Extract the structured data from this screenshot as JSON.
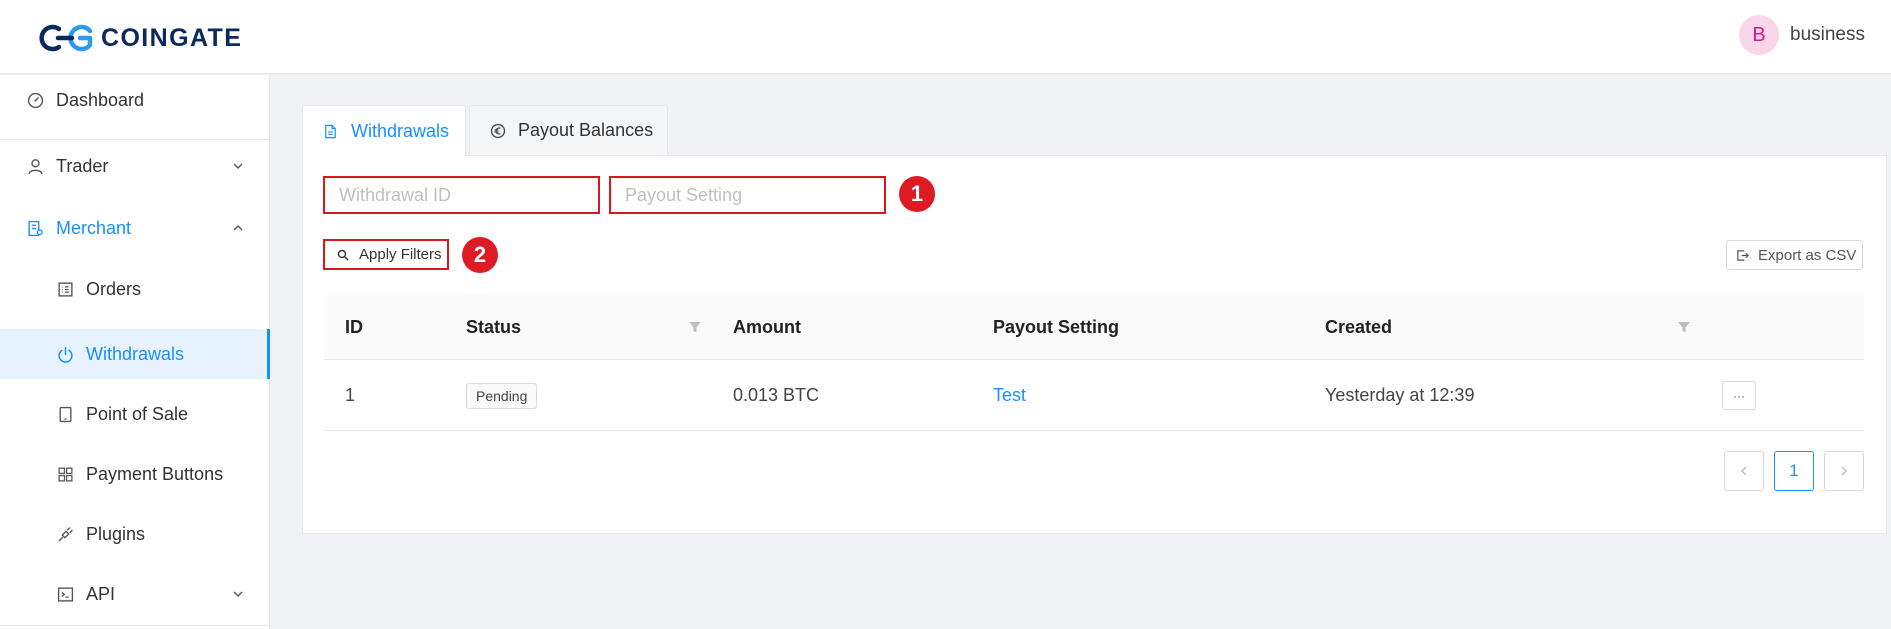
{
  "header": {
    "logo_text": "COINGATE",
    "avatar_initial": "B",
    "user_name": "business"
  },
  "sidebar": {
    "items": [
      {
        "label": "Dashboard",
        "icon": "dashboard-icon"
      },
      {
        "label": "Trader",
        "icon": "user-icon",
        "expandable": true
      },
      {
        "label": "Merchant",
        "icon": "merchant-icon",
        "expanded": true
      },
      {
        "label": "Orders",
        "icon": "orders-icon"
      },
      {
        "label": "Withdrawals",
        "icon": "power-icon",
        "active": true
      },
      {
        "label": "Point of Sale",
        "icon": "tablet-icon"
      },
      {
        "label": "Payment Buttons",
        "icon": "grid-icon"
      },
      {
        "label": "Plugins",
        "icon": "plug-icon"
      },
      {
        "label": "API",
        "icon": "terminal-icon",
        "expandable": true
      }
    ]
  },
  "tabs": [
    {
      "label": "Withdrawals",
      "icon": "file-icon",
      "active": true
    },
    {
      "label": "Payout Balances",
      "icon": "euro-icon"
    }
  ],
  "filters": {
    "withdrawal_id_placeholder": "Withdrawal ID",
    "payout_setting_placeholder": "Payout Setting",
    "apply_label": "Apply Filters",
    "export_label": "Export as CSV",
    "badge_1": "1",
    "badge_2": "2"
  },
  "table": {
    "columns": [
      "ID",
      "Status",
      "Amount",
      "Payout Setting",
      "Created"
    ],
    "rows": [
      {
        "id": "1",
        "status": "Pending",
        "amount": "0.013 BTC",
        "payout_setting": "Test",
        "created": "Yesterday at 12:39",
        "more": "···"
      }
    ]
  },
  "pagination": {
    "current_page": "1"
  },
  "colors": {
    "accent": "#1890ff",
    "highlight_red": "#d7191f",
    "brand_navy": "#0b2a5b"
  }
}
